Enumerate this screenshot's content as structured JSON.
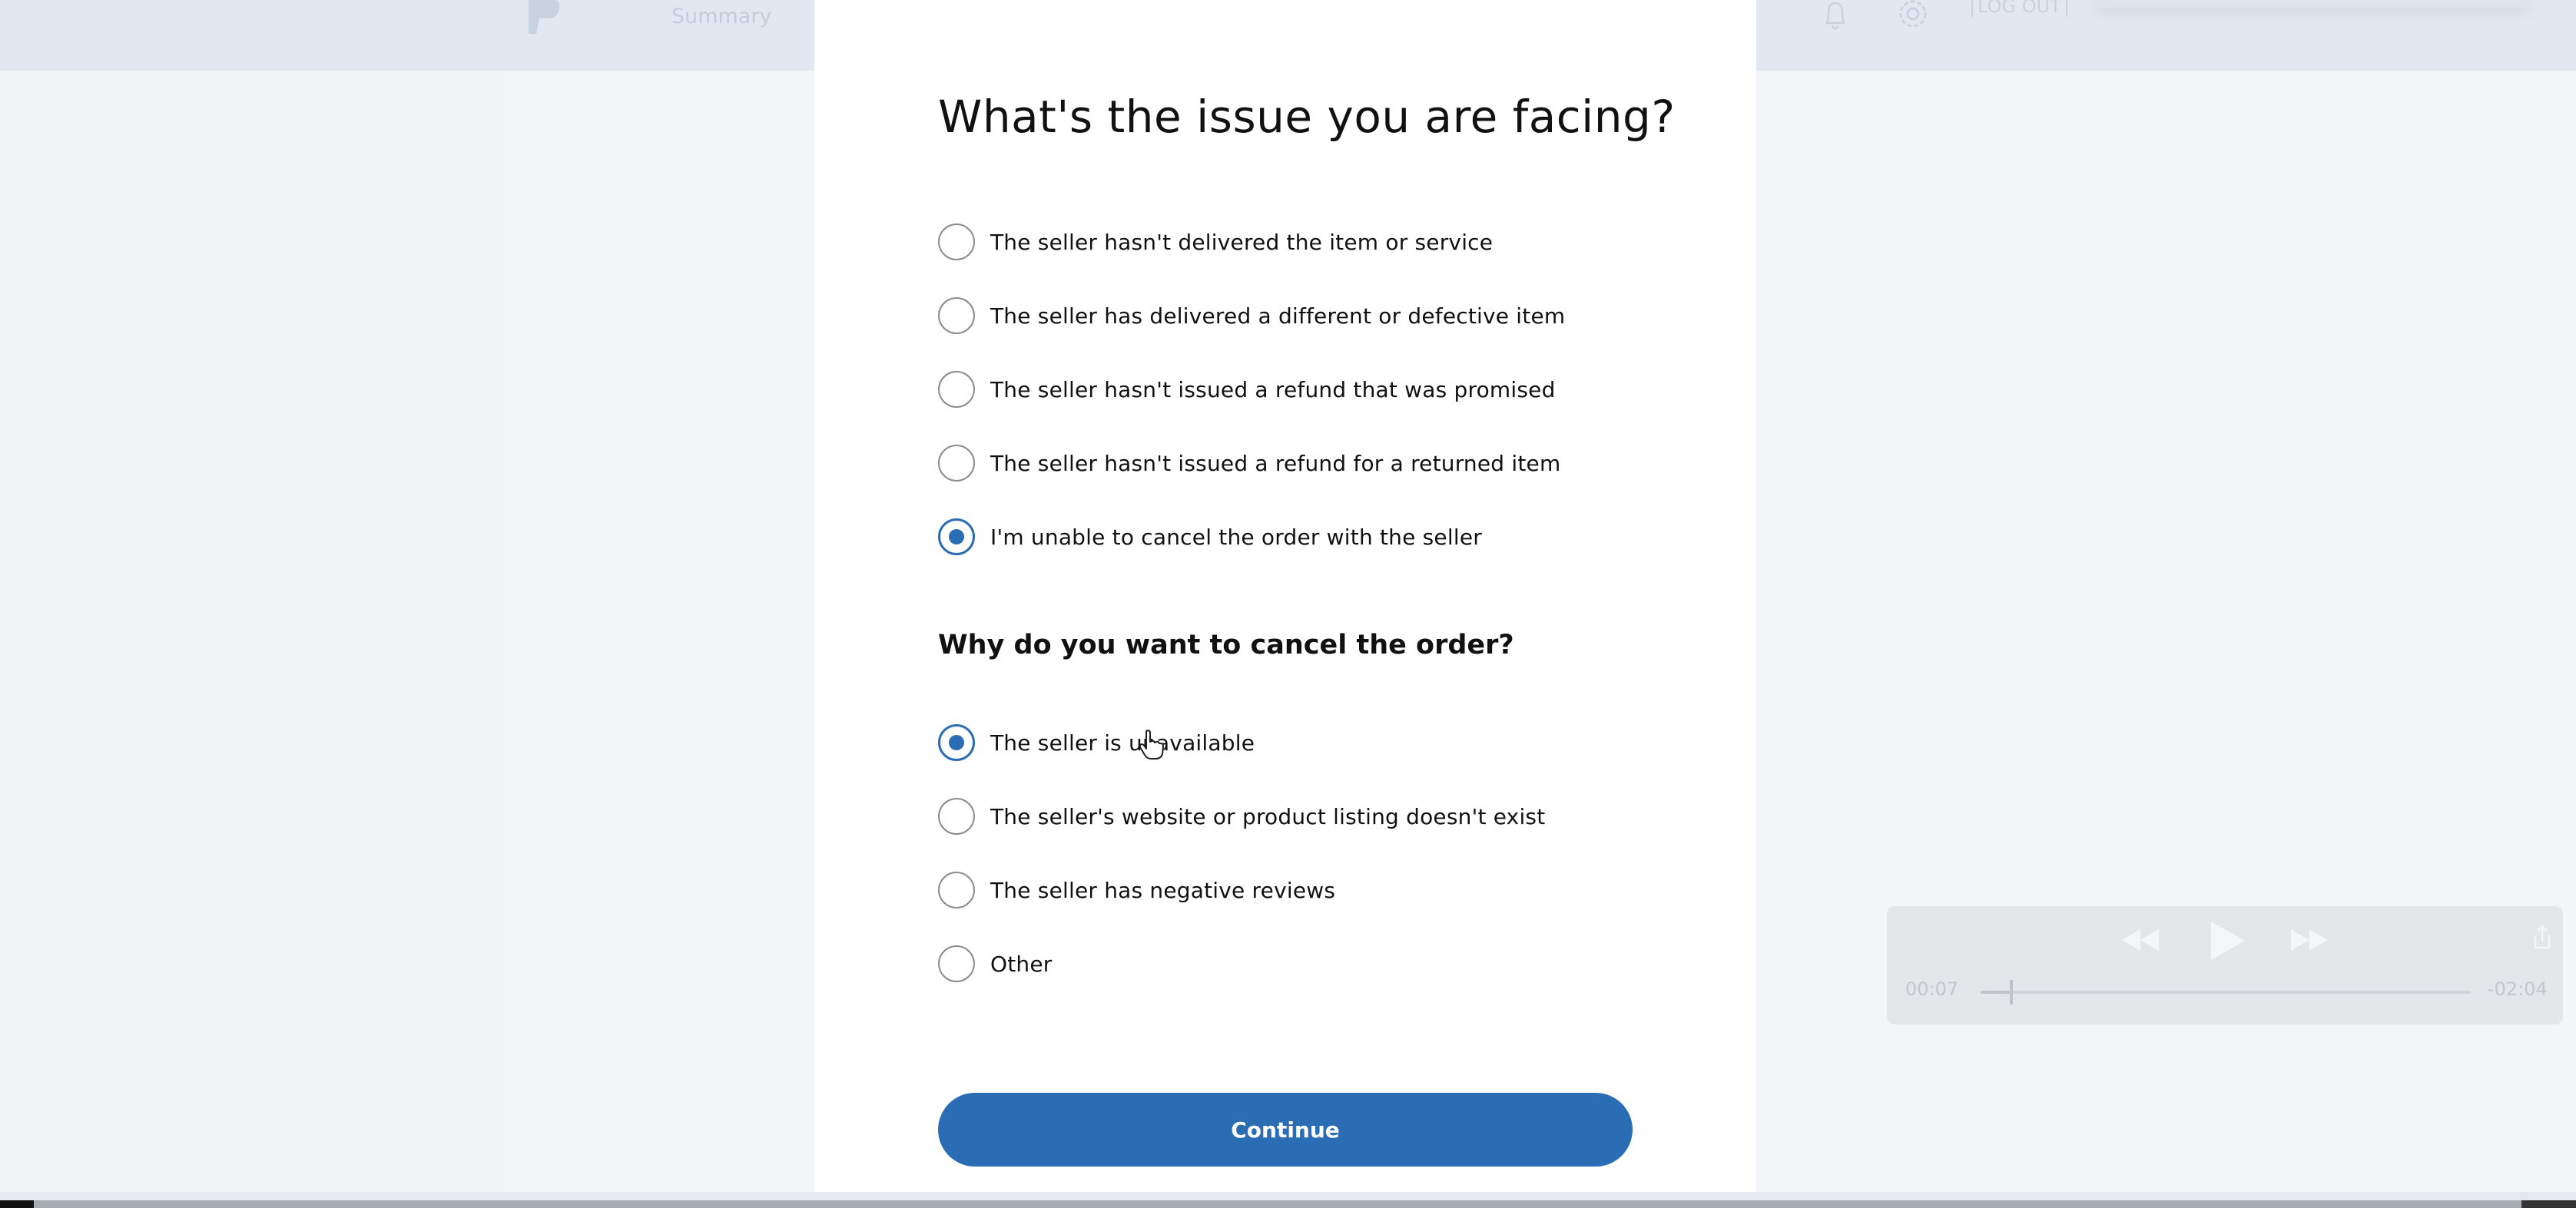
{
  "background": {
    "nav_summary": "Summary",
    "logout_label": "LOG OUT"
  },
  "modal": {
    "title": "What's the issue you are facing?",
    "issue_options": [
      {
        "label": "The seller hasn't delivered the item or service",
        "selected": false
      },
      {
        "label": "The seller has delivered a different or defective item",
        "selected": false
      },
      {
        "label": "The seller hasn't issued a refund that was promised",
        "selected": false
      },
      {
        "label": "The seller hasn't issued a refund for a returned item",
        "selected": false
      },
      {
        "label": "I'm unable to cancel the order with the seller",
        "selected": true
      }
    ],
    "reason_heading": "Why do you want to cancel the order?",
    "reason_options": [
      {
        "label": "The seller is unavailable",
        "selected": true
      },
      {
        "label": "The seller's website or product listing doesn't exist",
        "selected": false
      },
      {
        "label": "The seller has negative reviews",
        "selected": false
      },
      {
        "label": "Other",
        "selected": false
      }
    ],
    "continue_label": "Continue"
  },
  "player": {
    "elapsed": "00:07",
    "remaining": "-02:04",
    "progress": 0.06
  },
  "colors": {
    "accent": "#2a6db5",
    "modal_bg": "#ffffff",
    "page_bg": "#f3f5f9",
    "header_bg": "#e2e8f1"
  },
  "icons": {
    "logo": "paypal-logo-icon",
    "bell": "bell-icon",
    "gear": "gear-icon",
    "rewind": "rewind-icon",
    "play": "play-icon",
    "forward": "fast-forward-icon",
    "share": "share-icon",
    "cursor": "hand-pointer-icon"
  }
}
